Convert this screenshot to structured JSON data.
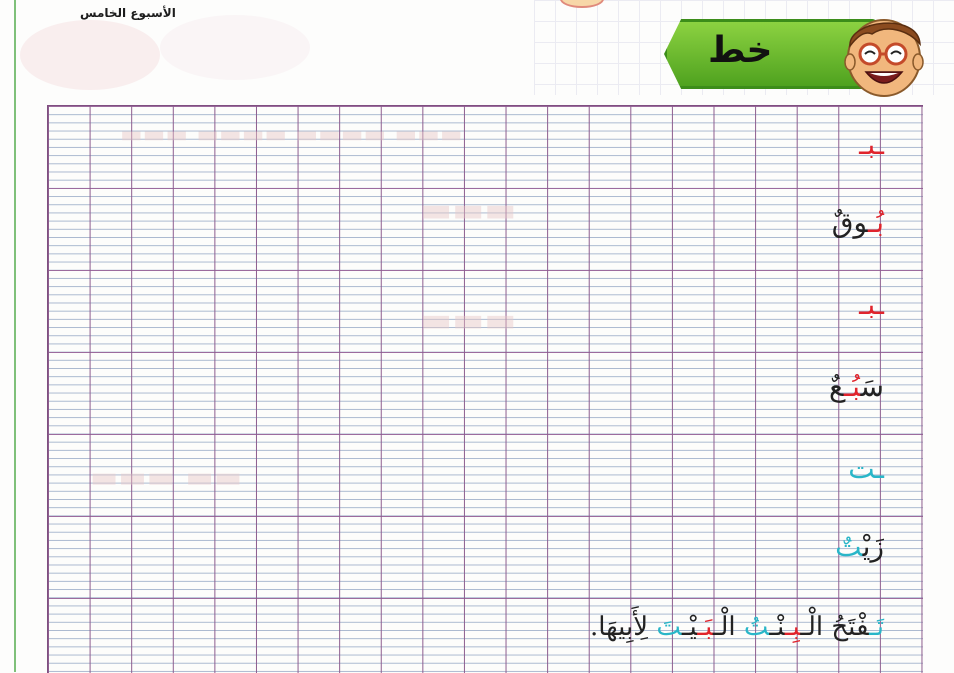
{
  "header": {
    "week_label": "الأسبوع الخامس"
  },
  "banner": {
    "title": "خط",
    "mascot_icon": "smiling-boy-with-glasses-icon",
    "colors": {
      "banner_fill": "#7ac13a",
      "banner_border": "#3c8d1a"
    }
  },
  "grid": {
    "colors": {
      "major_lines": "#8c5c8e",
      "minor_lines": "#a9b8cf"
    }
  },
  "practice_items": [
    {
      "id": "b-final",
      "parts": [
        {
          "text": "ـبـ",
          "color": "red"
        }
      ]
    },
    {
      "id": "bouq",
      "parts": [
        {
          "text": "بُـ",
          "color": "red"
        },
        {
          "text": "وقٌ",
          "color": "dark"
        }
      ]
    },
    {
      "id": "b-medial",
      "parts": [
        {
          "text": "ـبـ",
          "color": "red"
        }
      ]
    },
    {
      "id": "sab",
      "parts": [
        {
          "text": "سَ",
          "color": "dark"
        },
        {
          "text": "بُـ",
          "color": "red"
        },
        {
          "text": "عٌ",
          "color": "dark"
        }
      ]
    },
    {
      "id": "t",
      "parts": [
        {
          "text": "ـت",
          "color": "teal"
        }
      ]
    },
    {
      "id": "zayt",
      "parts": [
        {
          "text": "زَيْ",
          "color": "dark"
        },
        {
          "text": "تٌ",
          "color": "teal"
        }
      ]
    },
    {
      "id": "sentence",
      "parts": [
        {
          "text": "تَـ",
          "color": "teal"
        },
        {
          "text": "فْتَحُ الْـ",
          "color": "dark"
        },
        {
          "text": "بِـ",
          "color": "red"
        },
        {
          "text": "نْـ",
          "color": "dark"
        },
        {
          "text": "تُ",
          "color": "teal"
        },
        {
          "text": " الْـ",
          "color": "dark"
        },
        {
          "text": "بَـ",
          "color": "red"
        },
        {
          "text": "يْـ",
          "color": "dark"
        },
        {
          "text": "تَ",
          "color": "teal"
        },
        {
          "text": " لِأَبِيهَا.",
          "color": "dark"
        }
      ]
    }
  ]
}
